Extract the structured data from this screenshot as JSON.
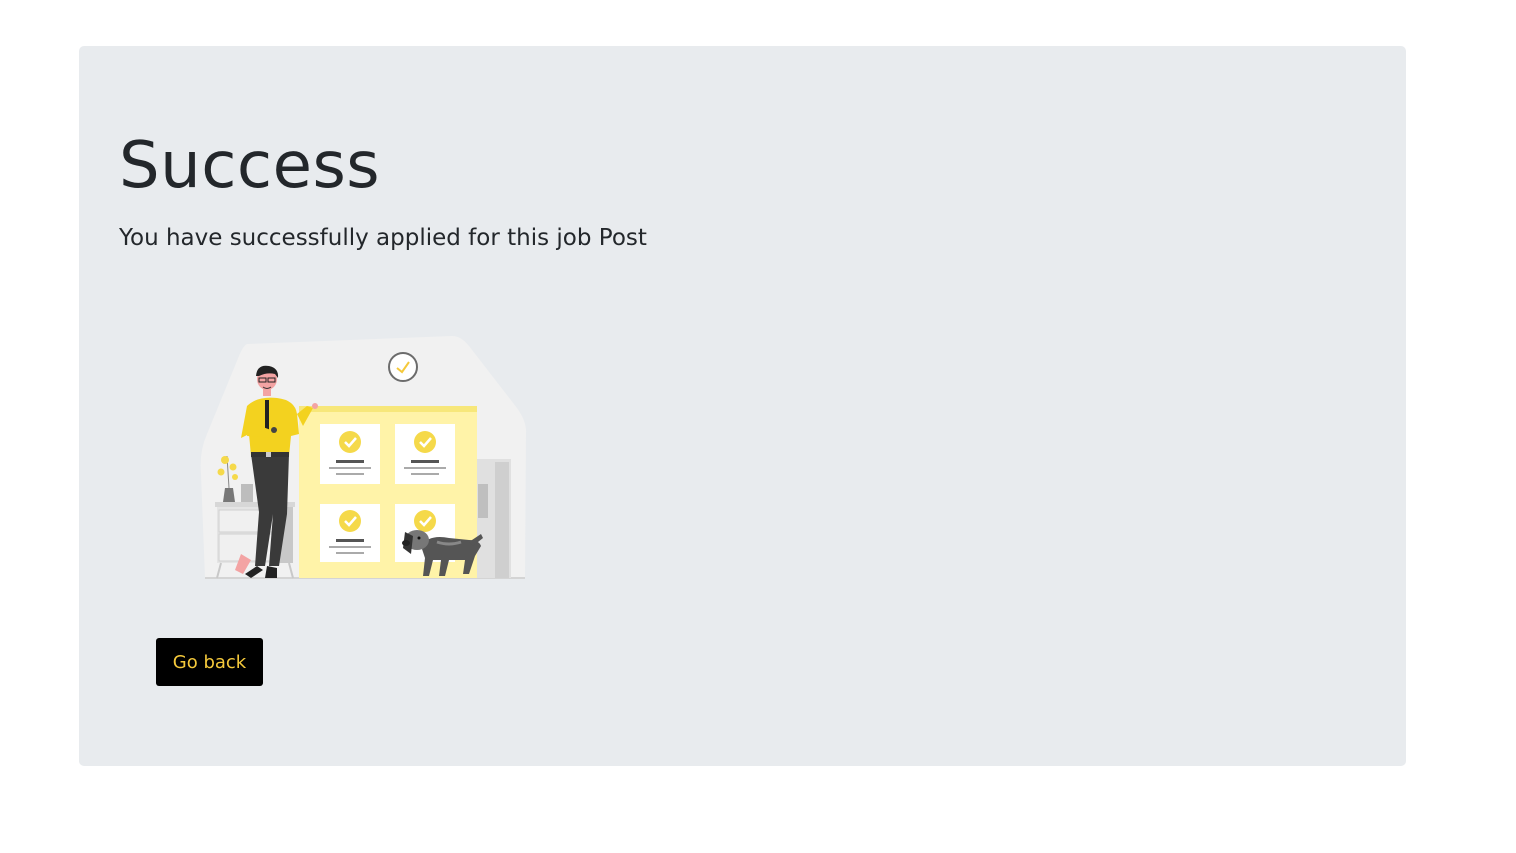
{
  "page": {
    "title": "Success",
    "message": "You have successfully applied for this job Post"
  },
  "actions": {
    "back_label": "Go back"
  },
  "illustration": {
    "description_icon": "success-illustration-icon"
  },
  "colors": {
    "card_background": "#e8ebee",
    "accent_yellow": "#f5c93b",
    "button_background": "#000000",
    "text": "#23272b"
  }
}
